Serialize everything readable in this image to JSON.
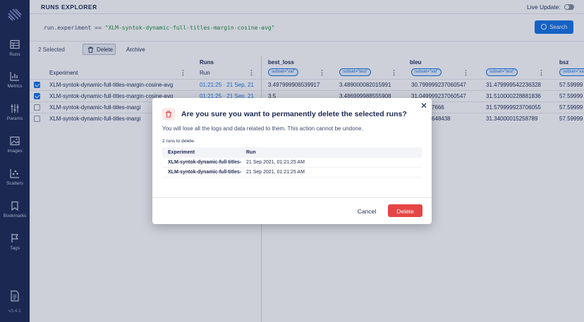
{
  "sidebar": {
    "items": [
      {
        "label": "Runs",
        "icon": "table-icon"
      },
      {
        "label": "Metrics",
        "icon": "chart-icon"
      },
      {
        "label": "Params",
        "icon": "sliders-icon"
      },
      {
        "label": "Images",
        "icon": "image-icon"
      },
      {
        "label": "Scatters",
        "icon": "scatter-icon"
      },
      {
        "label": "Bookmarks",
        "icon": "bookmark-icon"
      },
      {
        "label": "Tags",
        "icon": "flag-icon"
      }
    ],
    "version": "v3.4.1"
  },
  "header": {
    "title": "RUNS EXPLORER",
    "live_update_label": "Live Update:"
  },
  "search": {
    "query_prefix": "run.experiment == ",
    "query_value": "\"XLM-syntok-dynamic-full-titles-margin-cosine-avg\"",
    "button_label": "Search"
  },
  "toolbar": {
    "selected_count": "2 Selected",
    "delete_label": "Delete",
    "archive_label": "Archive"
  },
  "table": {
    "groups": {
      "runs": "Runs",
      "best_loss": "best_loss",
      "bleu": "bleu",
      "bsz": "bsz"
    },
    "headers": {
      "experiment": "Experiment",
      "run": "Run"
    },
    "pills": [
      "subset=\"val\"",
      "subset=\"test\"",
      "subset=\"val\"",
      "subset=\"test\"",
      "subset=\"val\""
    ],
    "rows": [
      {
        "experiment": "XLM-syntok-dynamic-full-titles-margin-cosine-avg",
        "run": "01:21:25 · 21 Sep, 21",
        "best_loss_val": "3.497999906539917",
        "best_loss_test": "3.489000082015991",
        "bleu_val": "30.799999237060547",
        "bleu_test": "31.479999542236328",
        "bsz": "57.59999",
        "checked": true
      },
      {
        "experiment": "XLM-syntok-dynamic-full-titles-margin-cosine-avg",
        "run": "01:21:25 · 21 Sep, 21",
        "best_loss_val": "3.5",
        "best_loss_test": "3.486999988555908",
        "bleu_val": "31.049999237060547",
        "bleu_test": "31.510000228881836",
        "bsz": "57.59999",
        "checked": true
      },
      {
        "experiment": "XLM-syntok-dynamic-full-titles-margi",
        "run": "",
        "best_loss_val": "",
        "best_loss_test": "",
        "bleu_val": "...991607666",
        "bleu_test": "31.579999923706055",
        "bsz": "57.59999",
        "checked": false
      },
      {
        "experiment": "XLM-syntok-dynamic-full-titles-margi",
        "run": "",
        "best_loss_val": "",
        "best_loss_test": "",
        "bleu_val": "...99389648438",
        "bleu_test": "31.34000015258789",
        "bsz": "57.59999",
        "checked": false
      }
    ]
  },
  "modal": {
    "title": "Are you sure you want to permanently delete the selected runs?",
    "description": "You will lose all the logs and data related to them. This action cannot be undone.",
    "count_text": "2 runs to delete.",
    "table_headers": {
      "experiment": "Experiment",
      "run": "Run"
    },
    "rows": [
      {
        "experiment": "XLM-syntok-dynamic-full-titles-",
        "run": "21 Sep 2021, 01:21:25 AM"
      },
      {
        "experiment": "XLM-syntok-dynamic-full-titles-",
        "run": "21 Sep 2021, 01:21:25 AM"
      }
    ],
    "cancel_label": "Cancel",
    "delete_label": "Delete",
    "close_symbol": "✕"
  },
  "colors": {
    "sidebar_bg": "#1c2852",
    "primary": "#1473e6",
    "danger": "#e64545",
    "query_string": "#1e8c3a"
  }
}
